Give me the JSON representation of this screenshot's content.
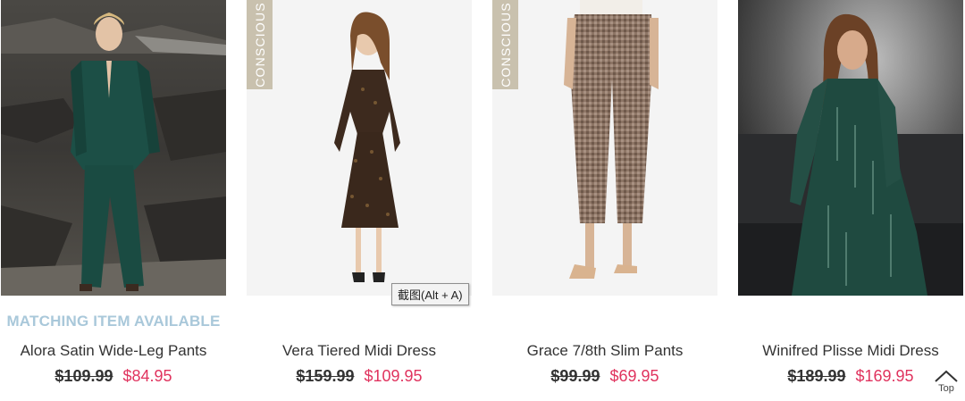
{
  "tooltip": "截图(Alt + A)",
  "back_to_top": "Top",
  "products": [
    {
      "name": "Alora Satin Wide-Leg Pants",
      "note": "MATCHING ITEM AVAILABLE",
      "price_was": "$109.99",
      "price_now": "$84.95"
    },
    {
      "name": "Vera Tiered Midi Dress",
      "badge": "CONSCIOUS",
      "price_was": "$159.99",
      "price_now": "$109.95"
    },
    {
      "name": "Grace 7/8th Slim Pants",
      "badge": "CONSCIOUS",
      "price_was": "$99.99",
      "price_now": "$69.95"
    },
    {
      "name": "Winifred Plisse Midi Dress",
      "price_was": "$189.99",
      "price_now": "$169.95"
    }
  ],
  "colors": {
    "sale_price": "#e0335e",
    "matching_note": "#a9c8da",
    "badge_bg": "#c9c1ae"
  }
}
